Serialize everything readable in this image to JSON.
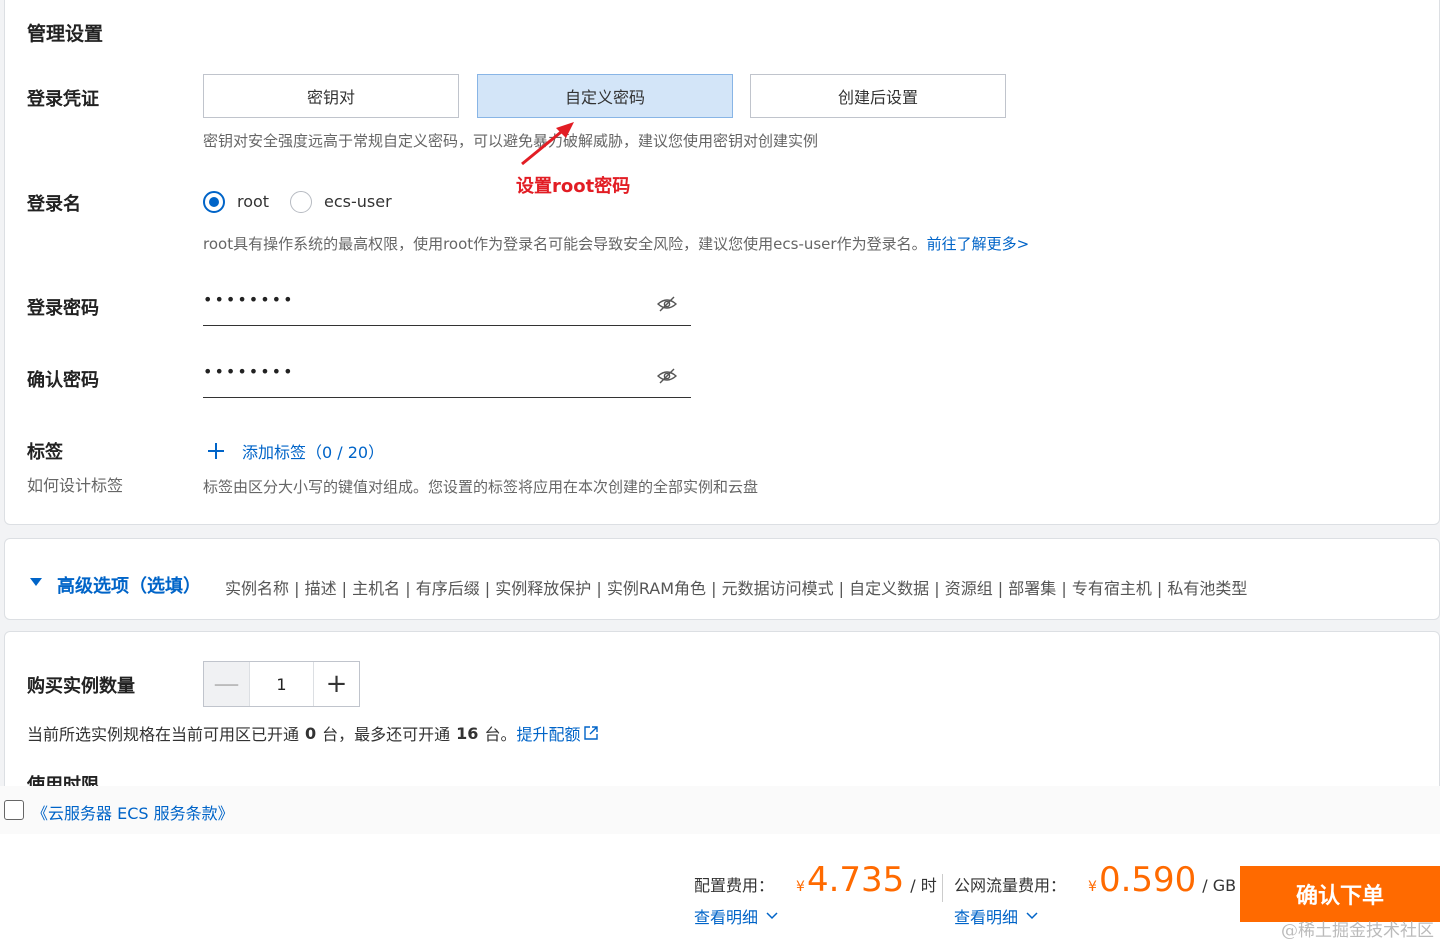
{
  "management": {
    "section_title": "管理设置",
    "credential": {
      "label": "登录凭证",
      "options": [
        "密钥对",
        "自定义密码",
        "创建后设置"
      ],
      "selected_index": 1,
      "hint": "密钥对安全强度远高于常规自定义密码，可以避免暴力破解威胁，建议您使用密钥对创建实例",
      "annotation": "设置root密码",
      "annotation_color": "#e21d24"
    },
    "login_name": {
      "label": "登录名",
      "options": [
        "root",
        "ecs-user"
      ],
      "selected": "root",
      "hint": "root具有操作系统的最高权限，使用root作为登录名可能会导致安全风险，建议您使用ecs-user作为登录名。",
      "learn_more": "前往了解更多>"
    },
    "password": {
      "label": "登录密码",
      "value": "••••••••"
    },
    "confirm_password": {
      "label": "确认密码",
      "value": "••••••••"
    },
    "tags": {
      "label": "标签",
      "sublabel": "如何设计标签",
      "add_label": "添加标签（0 / 20）",
      "hint": "标签由区分大小写的键值对组成。您设置的标签将应用在本次创建的全部实例和云盘"
    }
  },
  "advanced": {
    "title": "高级选项（选填）",
    "items": "实例名称 | 描述 | 主机名 | 有序后缀 | 实例释放保护 | 实例RAM角色 | 元数据访问模式 | 自定义数据 | 资源组 | 部署集 | 专有宿主机 | 私有池类型"
  },
  "purchase": {
    "label": "购买实例数量",
    "quantity": "1",
    "minus": "—",
    "plus": "+",
    "info_prefix": "当前所选实例规格在当前可用区已开通",
    "opened_count": "0",
    "info_mid": "台，最多还可开通",
    "available_count": "16",
    "info_suffix": "台。",
    "upgrade_link": "提升配额",
    "next_section_partial": "使用时限"
  },
  "terms": {
    "link": "《云服务器 ECS 服务条款》"
  },
  "bottom_bar": {
    "config_fee_label": "配置费用：",
    "config_yen": "¥",
    "config_price": "4.735",
    "config_unit": "/ 时",
    "config_detail": "查看明细",
    "traffic_fee_label": "公网流量费用：",
    "traffic_yen": "¥",
    "traffic_price": "0.590",
    "traffic_unit": "/ GB",
    "traffic_detail": "查看明细",
    "confirm_button": "确认下单",
    "watermark": "@稀土掘金技术社区"
  },
  "colors": {
    "accent": "#0064c8",
    "price": "#ff6a00",
    "confirm_button": "#ff6a00"
  }
}
